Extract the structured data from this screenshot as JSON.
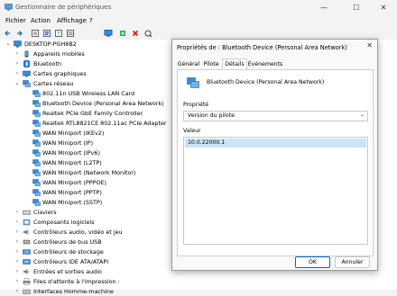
{
  "window": {
    "title": "Gestionnaire de périphériques",
    "controls": {
      "minimize": "—",
      "maximize": "☐",
      "close": "✕"
    }
  },
  "menu": [
    {
      "label": "Fichier"
    },
    {
      "label": "Action"
    },
    {
      "label": "Affichage"
    },
    {
      "label": "?"
    }
  ],
  "toolbar": {
    "icons": [
      "back-icon",
      "forward-icon",
      "properties-icon",
      "help-icon",
      "details-icon",
      "monitor-icon",
      "add-driver-icon",
      "uninstall-icon",
      "scan-icon"
    ]
  },
  "tree": {
    "root": "DESKTOP-PGH8B2",
    "items": [
      {
        "label": "Appareils mobiles",
        "expanded": false
      },
      {
        "label": "Bluetooth",
        "expanded": false
      },
      {
        "label": "Cartes graphiques",
        "expanded": false
      },
      {
        "label": "Cartes réseau",
        "expanded": true
      },
      {
        "label": "802.11n USB Wireless LAN Card",
        "child": true
      },
      {
        "label": "Bluetooth Device (Personal Area Network)",
        "child": true
      },
      {
        "label": "Realtek PCIe GbE Family Controller",
        "child": true
      },
      {
        "label": "Realtek RTL8821CE 802.11ac PCIe Adapter",
        "child": true
      },
      {
        "label": "WAN Miniport (IKEv2)",
        "child": true
      },
      {
        "label": "WAN Miniport (IP)",
        "child": true
      },
      {
        "label": "WAN Miniport (IPv6)",
        "child": true
      },
      {
        "label": "WAN Miniport (L2TP)",
        "child": true
      },
      {
        "label": "WAN Miniport (Network Monitor)",
        "child": true
      },
      {
        "label": "WAN Miniport (PPPOE)",
        "child": true
      },
      {
        "label": "WAN Miniport (PPTP)",
        "child": true
      },
      {
        "label": "WAN Miniport (SSTP)",
        "child": true
      },
      {
        "label": "Claviers",
        "expanded": false
      },
      {
        "label": "Composants logiciels",
        "expanded": false
      },
      {
        "label": "Contrôleurs audio, vidéo et jeu",
        "expanded": false
      },
      {
        "label": "Contrôleurs de bus USB",
        "expanded": false
      },
      {
        "label": "Contrôleurs de stockage",
        "expanded": false
      },
      {
        "label": "Contrôleurs IDE ATA/ATAPI",
        "expanded": false
      },
      {
        "label": "Entrées et sorties audio",
        "expanded": false
      },
      {
        "label": "Files d'attente à l'impression :",
        "expanded": false
      },
      {
        "label": "Interfaces Homme-machine",
        "expanded": false
      }
    ]
  },
  "dialog": {
    "title": "Propriétés de : Bluetooth Device (Personal Area Network)",
    "close": "✕",
    "tabs": [
      {
        "label": "Général"
      },
      {
        "label": "Pilote"
      },
      {
        "label": "Détails",
        "active": true
      },
      {
        "label": "Événements"
      }
    ],
    "device_name": "Bluetooth Device (Personal Area Network)",
    "property_label": "Propriété",
    "property_value": "Version du pilote",
    "value_label": "Valeur",
    "value_item": "10.0.22000.1",
    "ok": "OK",
    "cancel": "Annuler"
  },
  "colors": {
    "accent": "#0067c0",
    "selection": "#cce4f7"
  }
}
